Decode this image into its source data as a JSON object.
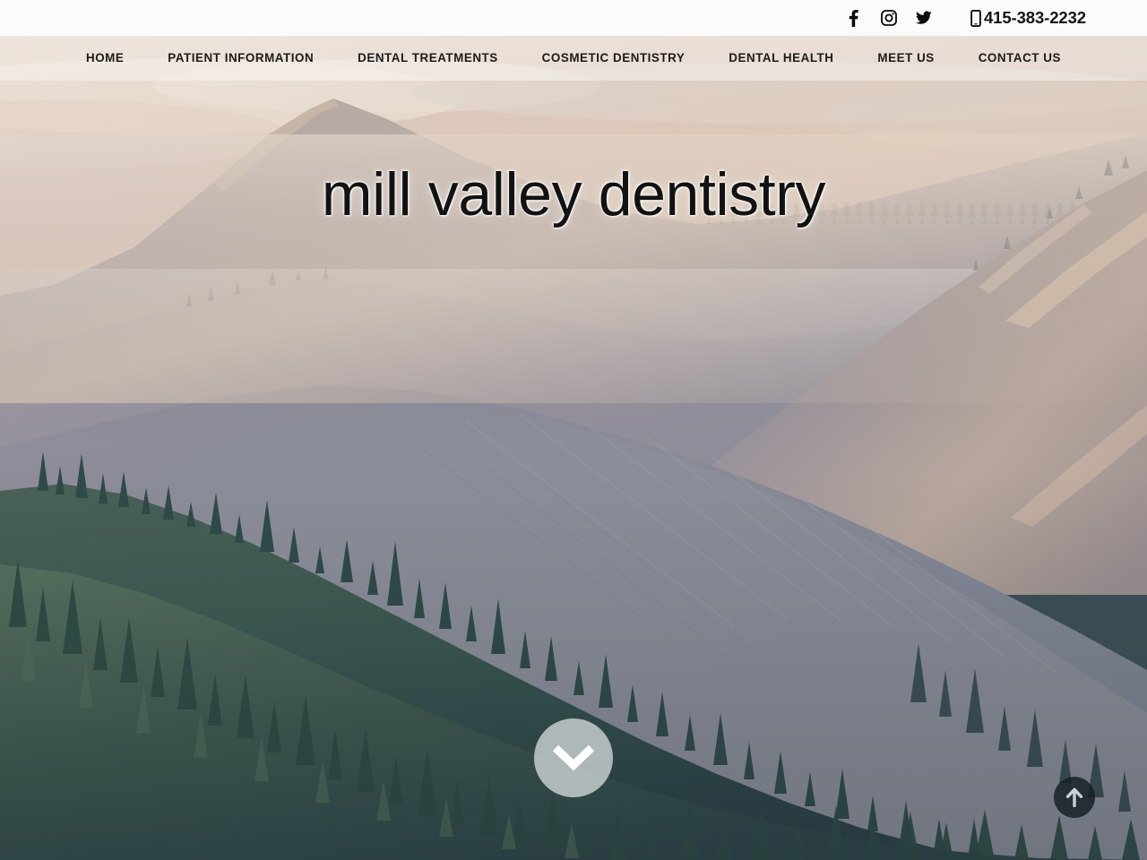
{
  "topbar": {
    "social": [
      {
        "name": "facebook-icon",
        "label": "Facebook"
      },
      {
        "name": "instagram-icon",
        "label": "Instagram"
      },
      {
        "name": "twitter-icon",
        "label": "Twitter"
      }
    ],
    "phone_icon": "mobile-phone-icon",
    "phone": "415-383-2232"
  },
  "nav": {
    "items": [
      {
        "label": "HOME"
      },
      {
        "label": "PATIENT INFORMATION"
      },
      {
        "label": "DENTAL TREATMENTS"
      },
      {
        "label": "COSMETIC DENTISTRY"
      },
      {
        "label": "DENTAL HEALTH"
      },
      {
        "label": "MEET US"
      },
      {
        "label": "CONTACT US"
      }
    ]
  },
  "hero": {
    "title": "mill valley dentistry",
    "scroll_down_icon": "chevron-down-icon",
    "background_alt": "misty layered mountain ridges with pine forest at dawn"
  },
  "back_to_top": {
    "icon": "arrow-up-icon"
  },
  "colors": {
    "topbar_bg": "#fbfbfb",
    "nav_bg": "#fcfaf8",
    "nav_text": "#1b1b1b",
    "phone_text": "#141414",
    "hero_title": "#121212",
    "scroll_btn_bg": "#e5e9e9",
    "totop_btn_bg": "#121c21",
    "sky_warm": "#e8cfc0",
    "ridge_far": "#b9afb2",
    "ridge_mid": "#8d949c",
    "forest_dark": "#34484b",
    "forest_green": "#3f5a4e"
  }
}
